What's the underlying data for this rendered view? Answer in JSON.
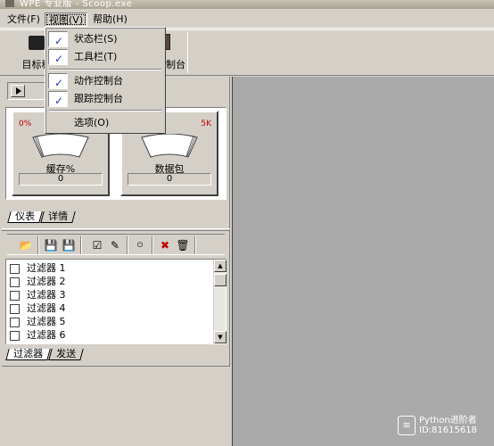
{
  "window": {
    "title": "WPE 专业版 - Scoop.exe"
  },
  "menubar": {
    "items": [
      {
        "label": "文件(F)"
      },
      {
        "label": "视图(V)"
      },
      {
        "label": "帮助(H)"
      }
    ]
  },
  "toolbar": {
    "target_label": "目标程",
    "console_label": "制台"
  },
  "view_menu": {
    "items": [
      {
        "label": "状态栏(S)",
        "checked": true
      },
      {
        "label": "工具栏(T)",
        "checked": true
      },
      {
        "label": "动作控制台",
        "checked": true
      },
      {
        "label": "跟踪控制台",
        "checked": true
      },
      {
        "label": "选项(O)",
        "checked": false
      }
    ],
    "check_glyph": "✓"
  },
  "gauges": [
    {
      "min_label": "0%",
      "max_label": "",
      "label": "缓存%",
      "value": "0"
    },
    {
      "min_label": "",
      "max_label": "5K",
      "label": "数据包",
      "value": "0"
    }
  ],
  "gauge_tabs": [
    "仪表",
    "详情"
  ],
  "filters": {
    "items": [
      {
        "label": "过滤器 1"
      },
      {
        "label": "过滤器 2"
      },
      {
        "label": "过滤器 3"
      },
      {
        "label": "过滤器 4"
      },
      {
        "label": "过滤器 5"
      },
      {
        "label": "过滤器 6"
      }
    ],
    "scroll_up": "▲",
    "scroll_down": "▼"
  },
  "filter_tabs": [
    "过滤器",
    "发送"
  ],
  "filter_toolbar_icons": [
    "open-folder-icon",
    "save-icon",
    "save-all-icon",
    "check-icon",
    "edit-icon",
    "on-off-icon",
    "delete-icon",
    "trash-icon"
  ],
  "watermark": {
    "logo": "≡",
    "line1": "Python进阶者",
    "line2": "ID:81615618"
  },
  "colors": {
    "check": "#1a3fa8",
    "gauge_scale": "#c00000",
    "workspace": "#aaaaaa"
  }
}
